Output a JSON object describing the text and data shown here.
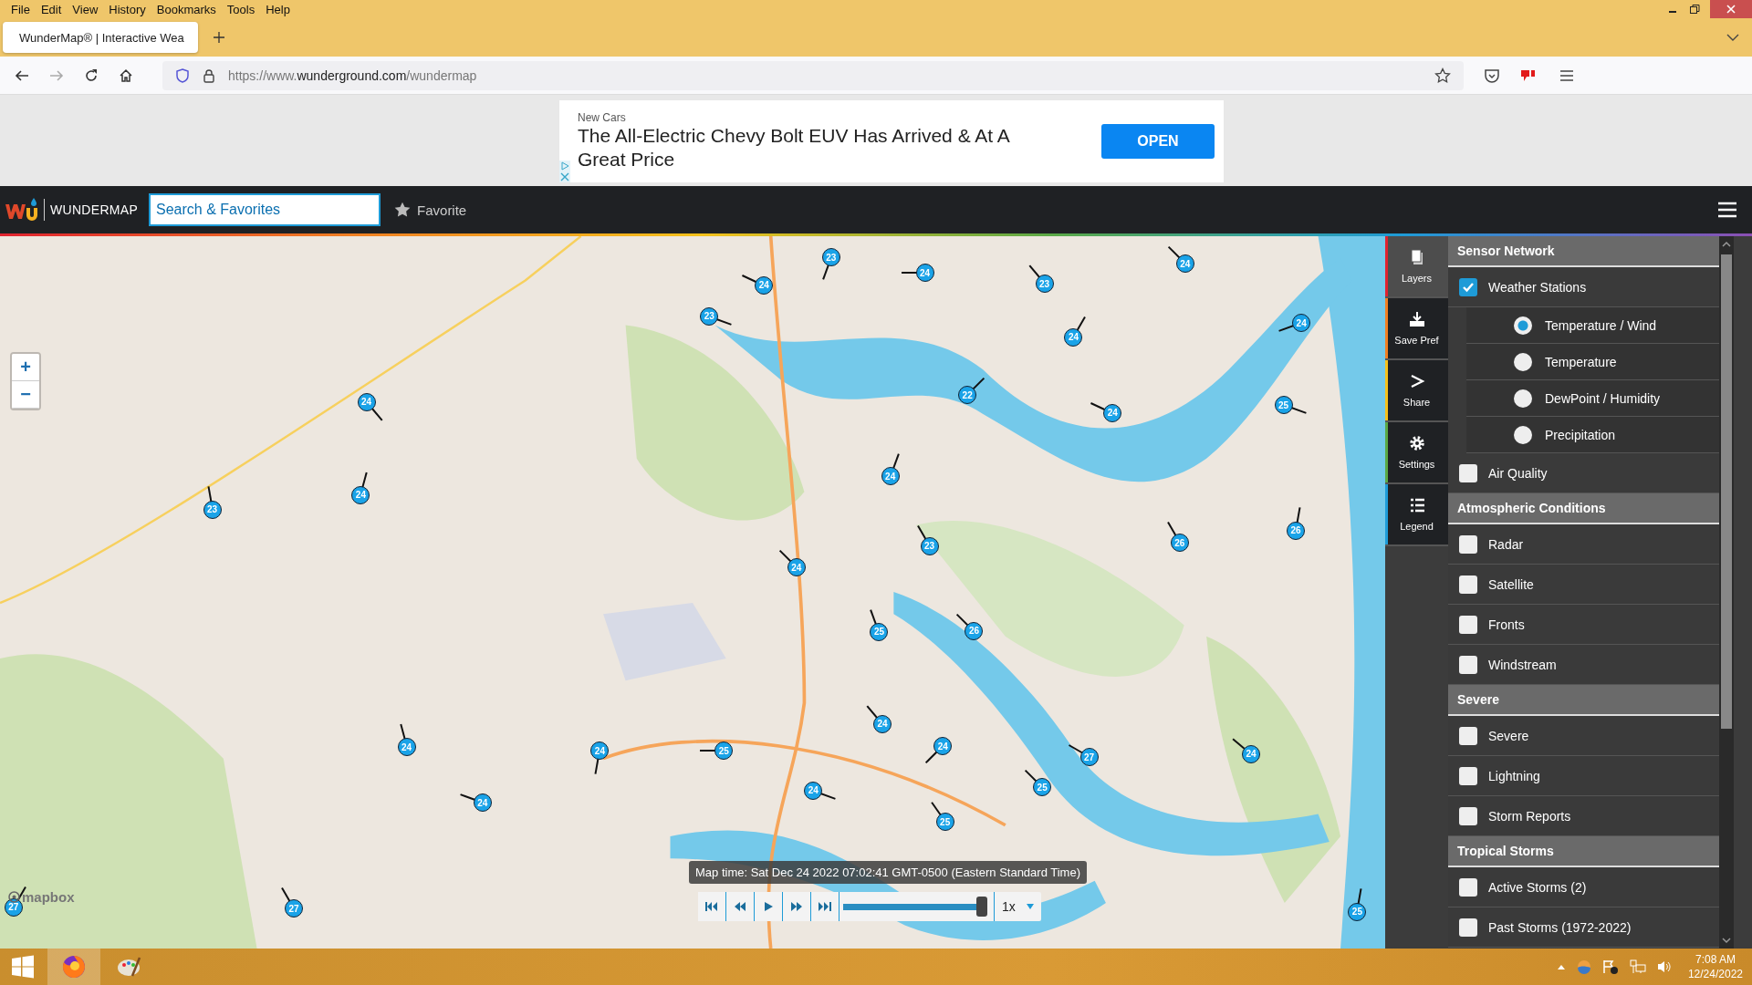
{
  "browser": {
    "menu": [
      "File",
      "Edit",
      "View",
      "History",
      "Bookmarks",
      "Tools",
      "Help"
    ],
    "tab": {
      "title": "WunderMap® | Interactive Wea",
      "selected": true
    },
    "url": {
      "scheme": "https://www.",
      "domain": "wunderground.com",
      "path": "/wundermap"
    }
  },
  "ad": {
    "label": "New Cars",
    "headline": "The All-Electric Chevy Bolt EUV Has Arrived & At A Great Price",
    "button": "OPEN"
  },
  "header": {
    "brand": "WUNDERMAP",
    "search": {
      "placeholder": "Search & Favorites"
    },
    "favorite": "Favorite"
  },
  "map": {
    "kind": "picture",
    "zoom_in": "+",
    "zoom_out": "−",
    "attribution": "mapbox",
    "stations": [
      {
        "value": "23"
      },
      {
        "value": "24"
      },
      {
        "value": "24"
      },
      {
        "value": "24"
      },
      {
        "value": "23"
      },
      {
        "value": "23"
      },
      {
        "value": "24"
      },
      {
        "value": "24"
      },
      {
        "value": "24"
      },
      {
        "value": "22"
      },
      {
        "value": "24"
      },
      {
        "value": "25"
      },
      {
        "value": "24"
      },
      {
        "value": "23"
      },
      {
        "value": "24"
      },
      {
        "value": "23"
      },
      {
        "value": "26"
      },
      {
        "value": "26"
      },
      {
        "value": "24"
      },
      {
        "value": "25"
      },
      {
        "value": "26"
      },
      {
        "value": "24"
      },
      {
        "value": "24"
      },
      {
        "value": "24"
      },
      {
        "value": "25"
      },
      {
        "value": "24"
      },
      {
        "value": "27"
      },
      {
        "value": "24"
      },
      {
        "value": "24"
      },
      {
        "value": "24"
      },
      {
        "value": "25"
      },
      {
        "value": "25"
      },
      {
        "value": "27"
      },
      {
        "value": "27"
      },
      {
        "value": "25"
      }
    ]
  },
  "playback": {
    "map_time": "Map time: Sat Dec 24 2022 07:02:41 GMT-0500 (Eastern Standard Time)",
    "level": 0.97,
    "speed": "1x"
  },
  "side_tabs": [
    {
      "label": "Layers",
      "selected": true,
      "color": "#e0232f"
    },
    {
      "label": "Save Pref",
      "selected": false,
      "color": "#f07f22"
    },
    {
      "label": "Share",
      "selected": false,
      "color": "#f5c11b"
    },
    {
      "label": "Settings",
      "selected": false,
      "color": "#5aa846"
    },
    {
      "label": "Legend",
      "selected": false,
      "color": "#1e9bd7"
    }
  ],
  "layers": [
    {
      "title": "Sensor Network",
      "items": [
        {
          "kind": "checkbox",
          "label": "Weather Stations",
          "checked": true
        },
        {
          "kind": "radio",
          "label": "Temperature / Wind",
          "selected": true
        },
        {
          "kind": "radio",
          "label": "Temperature",
          "selected": false
        },
        {
          "kind": "radio",
          "label": "DewPoint / Humidity",
          "selected": false
        },
        {
          "kind": "radio",
          "label": "Precipitation",
          "selected": false
        },
        {
          "kind": "checkbox",
          "label": "Air Quality",
          "checked": false
        }
      ]
    },
    {
      "title": "Atmospheric Conditions",
      "items": [
        {
          "kind": "checkbox",
          "label": "Radar",
          "checked": false
        },
        {
          "kind": "checkbox",
          "label": "Satellite",
          "checked": false
        },
        {
          "kind": "checkbox",
          "label": "Fronts",
          "checked": false
        },
        {
          "kind": "checkbox",
          "label": "Windstream",
          "checked": false
        }
      ]
    },
    {
      "title": "Severe",
      "items": [
        {
          "kind": "checkbox",
          "label": "Severe",
          "checked": false
        },
        {
          "kind": "checkbox",
          "label": "Lightning",
          "checked": false
        },
        {
          "kind": "checkbox",
          "label": "Storm Reports",
          "checked": false
        }
      ]
    },
    {
      "title": "Tropical Storms",
      "items": [
        {
          "kind": "checkbox",
          "label": "Active Storms (2)",
          "checked": false
        },
        {
          "kind": "checkbox",
          "label": "Past Storms (1972-2022)",
          "checked": false
        }
      ]
    }
  ],
  "taskbar": {
    "time": "7:08 AM",
    "date": "12/24/2022"
  }
}
